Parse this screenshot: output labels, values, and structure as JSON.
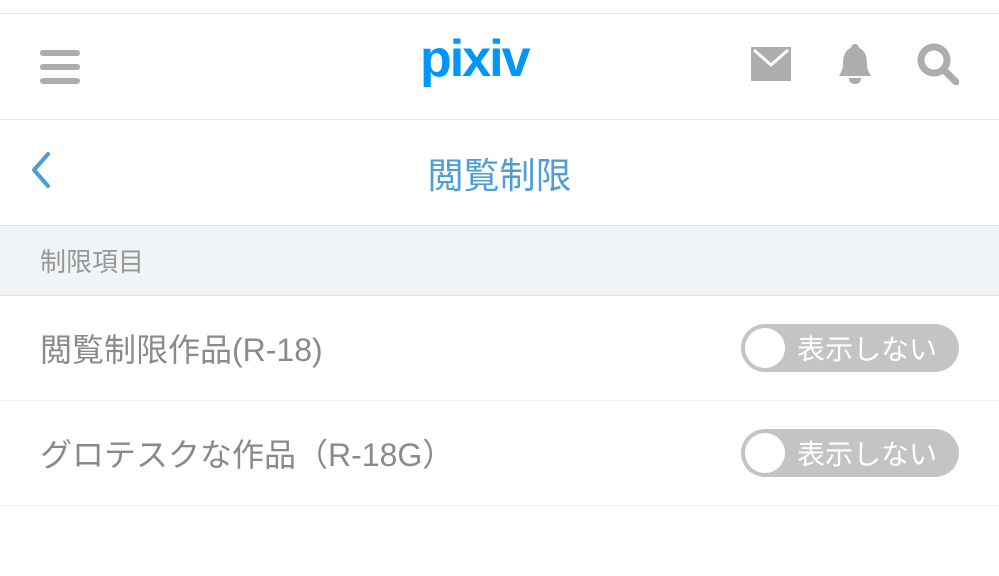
{
  "header": {
    "logo_text": "pixiv"
  },
  "subheader": {
    "title": "閲覧制限"
  },
  "section": {
    "header": "制限項目"
  },
  "settings": [
    {
      "label": "閲覧制限作品(R-18)",
      "toggle_text": "表示しない"
    },
    {
      "label": "グロテスクな作品（R-18G）",
      "toggle_text": "表示しない"
    }
  ]
}
